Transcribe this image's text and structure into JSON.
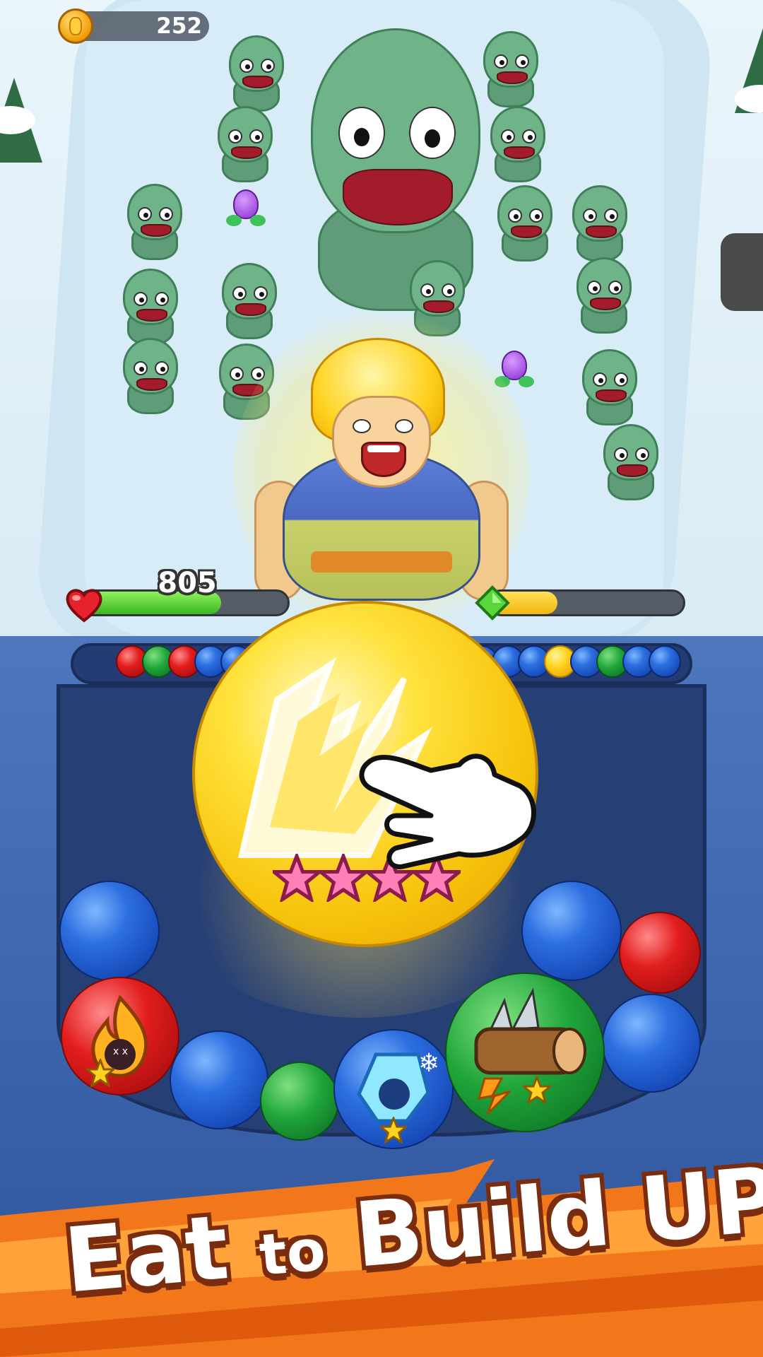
{
  "hud": {
    "coins": "252",
    "health": "805",
    "health_fraction": 0.68,
    "xp_fraction": 0.35
  },
  "board": {
    "tube_balls": [
      "red",
      "green",
      "red",
      "blue",
      "blue",
      "blue",
      "blue",
      "blue",
      "yellow",
      "blue",
      "green",
      "blue",
      "blue"
    ],
    "main_ball": {
      "color": "yellow",
      "stars": 4,
      "icon": "lightning-icon"
    },
    "balls": [
      {
        "color": "blue"
      },
      {
        "color": "blue"
      },
      {
        "color": "red"
      },
      {
        "color": "blue"
      },
      {
        "color": "green"
      },
      {
        "color": "blue"
      },
      {
        "color": "blue"
      }
    ],
    "special_balls": [
      {
        "name": "fire-ball",
        "icon": "flame-skull-icon",
        "stars": 1
      },
      {
        "name": "ice-ball",
        "icon": "frozen-skull-icon",
        "stars": 1
      },
      {
        "name": "spiked-log-ball",
        "icon": "spiked-log-icon",
        "stars": 1
      }
    ]
  },
  "banner": {
    "word1": "Eat",
    "word2": "to",
    "word3": "Build UP!"
  },
  "colors": {
    "banner": "#f2761a",
    "board": "#3a62aa",
    "hp": "#3cb521",
    "xp": "#f0b70d"
  }
}
